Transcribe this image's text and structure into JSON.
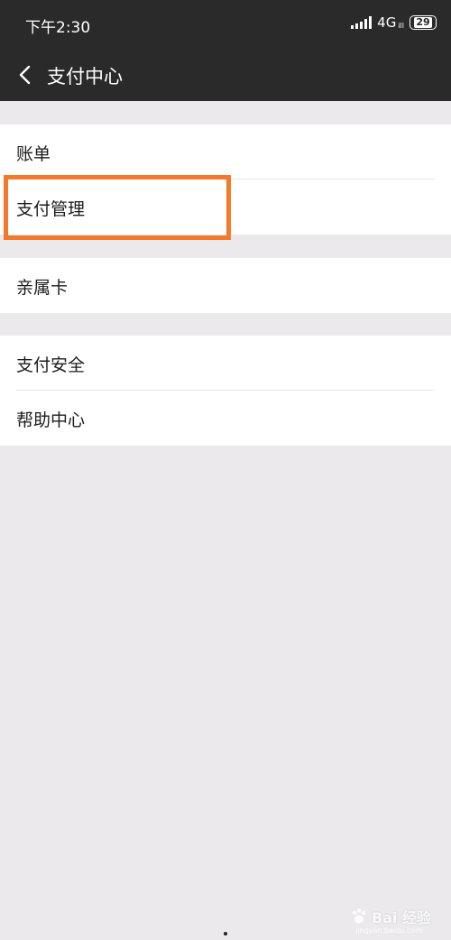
{
  "status_bar": {
    "time": "下午2:30",
    "network": "4G",
    "network_sub": "ill",
    "battery": "29"
  },
  "nav": {
    "title": "支付中心",
    "back_icon": "chevron-left-icon"
  },
  "groups": [
    {
      "items": [
        {
          "label": "账单"
        },
        {
          "label": "支付管理"
        }
      ]
    },
    {
      "items": [
        {
          "label": "亲属卡"
        }
      ]
    },
    {
      "items": [
        {
          "label": "支付安全"
        },
        {
          "label": "帮助中心"
        }
      ]
    }
  ],
  "highlight": {
    "target": "支付管理",
    "color": "#f37a2b"
  },
  "watermark": {
    "text": "Bai 经验",
    "sub": "jingyan.baidu.com"
  },
  "colors": {
    "header_bg": "#2a2a2a",
    "page_bg": "#ebe9ec",
    "accent": "#f37a2b"
  }
}
